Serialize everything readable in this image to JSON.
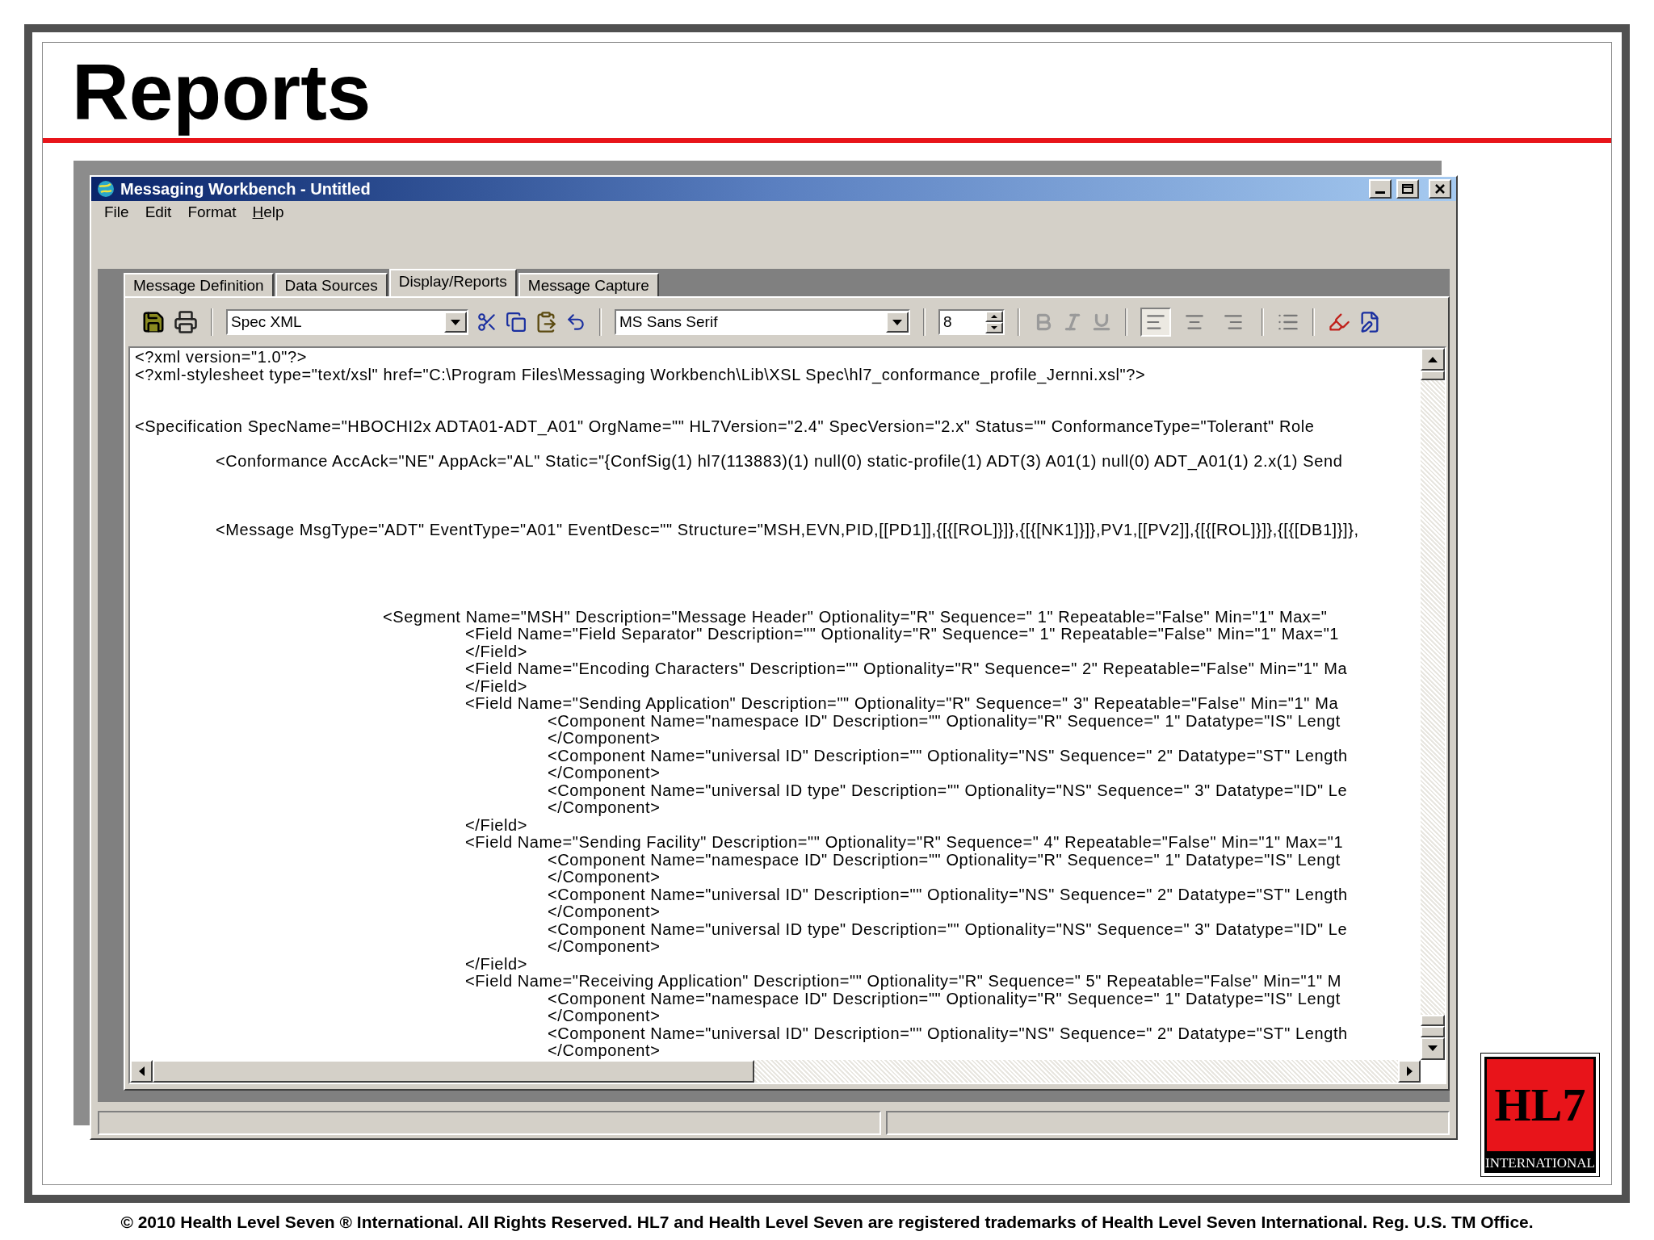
{
  "slide": {
    "title": "Reports",
    "footer": "© 2010 Health Level Seven ® International. All Rights Reserved. HL7 and Health Level Seven are registered trademarks of Health Level Seven International. Reg. U.S. TM Office.",
    "logo": {
      "mark": "HL7",
      "caption": "INTERNATIONAL"
    }
  },
  "window": {
    "title": "Messaging Workbench - Untitled",
    "menu": [
      {
        "label": "File",
        "mnemonic_underlined": false
      },
      {
        "label": "Edit",
        "mnemonic_underlined": false
      },
      {
        "label": "Format",
        "mnemonic_underlined": false
      },
      {
        "label": "Help",
        "mnemonic_underlined": true
      }
    ],
    "tabs": [
      {
        "label": "Message Definition",
        "selected": false
      },
      {
        "label": "Data Sources",
        "selected": false
      },
      {
        "label": "Display/Reports",
        "selected": true
      },
      {
        "label": "Message Capture",
        "selected": false
      }
    ],
    "toolbar": {
      "report_select": "Spec XML",
      "font_select": "MS Sans Serif",
      "font_size": "8",
      "format_buttons_disabled": true,
      "alignment": [
        {
          "kind": "left",
          "selected": true
        },
        {
          "kind": "center",
          "selected": false
        },
        {
          "kind": "right",
          "selected": false
        }
      ]
    },
    "editor": {
      "lines": [
        {
          "text": "<?xml version=\"1.0\"?>"
        },
        {
          "text": "<?xml-stylesheet type=\"text/xsl\" href=\"C:\\Program Files\\Messaging Workbench\\Lib\\XSL Spec\\hl7_conformance_profile_Jernni.xsl\"?>"
        },
        {
          "text": "<Specification SpecName=\"HBOCHI2x ADTA01-ADT_A01\" OrgName=\"\" HL7Version=\"2.4\" SpecVersion=\"2.x\" Status=\"\" ConformanceType=\"Tolerant\" Role",
          "children": [
            {
              "text": "<Conformance AccAck=\"NE\" AppAck=\"AL\" Static=\"{ConfSig(1) hl7(113883)(1) null(0) static-profile(1) ADT(3) A01(1) null(0) ADT_A01(1) 2.x(1) Send"
            },
            {
              "text": "<Message MsgType=\"ADT\" EventType=\"A01\" EventDesc=\"\" Structure=\"MSH,EVN,PID,[[PD1]],{[{[ROL]}]},{[{[NK1]}]},PV1,[[PV2]],{[{[ROL]}]},{[{[DB1]}]},",
              "children": [
                {
                  "text": "<Segment Name=\"MSH\" Description=\"Message Header\" Optionality=\"R\" Sequence=\" 1\" Repeatable=\"False\" Min=\"1\" Max=\"",
                  "children": [
                    {
                      "text": "<Field Name=\"Field Separator\" Description=\"\" Optionality=\"R\" Sequence=\" 1\" Repeatable=\"False\" Min=\"1\" Max=\"1"
                    },
                    {
                      "text": "</Field>"
                    },
                    {
                      "text": "<Field Name=\"Encoding Characters\" Description=\"\" Optionality=\"R\" Sequence=\" 2\" Repeatable=\"False\" Min=\"1\" Ma"
                    },
                    {
                      "text": "</Field>"
                    },
                    {
                      "text": "<Field Name=\"Sending Application\" Description=\"\" Optionality=\"R\" Sequence=\" 3\" Repeatable=\"False\" Min=\"1\" Ma",
                      "children": [
                        {
                          "text": "<Component Name=\"namespace ID\" Description=\"\" Optionality=\"R\" Sequence=\" 1\" Datatype=\"IS\" Lengt"
                        },
                        {
                          "text": "</Component>"
                        },
                        {
                          "text": "<Component Name=\"universal ID\" Description=\"\" Optionality=\"NS\" Sequence=\" 2\" Datatype=\"ST\" Length"
                        },
                        {
                          "text": "</Component>"
                        },
                        {
                          "text": "<Component Name=\"universal ID type\" Description=\"\" Optionality=\"NS\" Sequence=\" 3\" Datatype=\"ID\" Le"
                        },
                        {
                          "text": "</Component>"
                        }
                      ]
                    },
                    {
                      "text": "</Field>"
                    },
                    {
                      "text": "<Field Name=\"Sending Facility\" Description=\"\" Optionality=\"R\" Sequence=\" 4\" Repeatable=\"False\" Min=\"1\" Max=\"1",
                      "children": [
                        {
                          "text": "<Component Name=\"namespace ID\" Description=\"\" Optionality=\"R\" Sequence=\" 1\" Datatype=\"IS\" Lengt"
                        },
                        {
                          "text": "</Component>"
                        },
                        {
                          "text": "<Component Name=\"universal ID\" Description=\"\" Optionality=\"NS\" Sequence=\" 2\" Datatype=\"ST\" Length"
                        },
                        {
                          "text": "</Component>"
                        },
                        {
                          "text": "<Component Name=\"universal ID type\" Description=\"\" Optionality=\"NS\" Sequence=\" 3\" Datatype=\"ID\" Le"
                        },
                        {
                          "text": "</Component>"
                        }
                      ]
                    },
                    {
                      "text": "</Field>"
                    },
                    {
                      "text": "<Field Name=\"Receiving Application\" Description=\"\" Optionality=\"R\" Sequence=\" 5\" Repeatable=\"False\" Min=\"1\" M",
                      "children": [
                        {
                          "text": "<Component Name=\"namespace ID\" Description=\"\" Optionality=\"R\" Sequence=\" 1\" Datatype=\"IS\" Lengt"
                        },
                        {
                          "text": "</Component>"
                        },
                        {
                          "text": "<Component Name=\"universal ID\" Description=\"\" Optionality=\"NS\" Sequence=\" 2\" Datatype=\"ST\" Length"
                        },
                        {
                          "text": "</Component>"
                        }
                      ]
                    }
                  ]
                }
              ]
            }
          ]
        }
      ]
    }
  }
}
